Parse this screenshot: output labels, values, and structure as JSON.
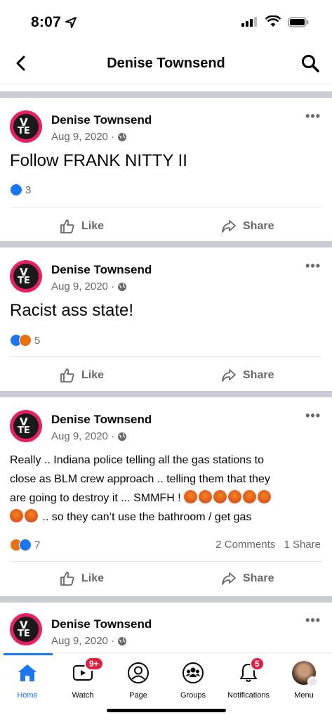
{
  "status_bar": {
    "time": "8:07"
  },
  "header": {
    "title": "Denise Townsend"
  },
  "avatar": {
    "top": "V",
    "bottom": "TE"
  },
  "posts": [
    {
      "author": "Denise Townsend",
      "date": "Aug 9, 2020 ·",
      "text": "Follow FRANK NITTY  II",
      "reaction_count": "3",
      "like_label": "Like",
      "share_label": "Share"
    },
    {
      "author": "Denise Townsend",
      "date": "Aug 9, 2020 ·",
      "text": "Racist ass state!",
      "reaction_count": "5",
      "like_label": "Like",
      "share_label": "Share"
    },
    {
      "author": "Denise Townsend",
      "date": "Aug 9, 2020 ·",
      "text_lines": [
        "Really .. Indiana police telling all the gas stations to",
        "close as BLM crew approach .. telling them that they",
        "are going to destroy it ... SMMFH !",
        ".. so they can’t use the bathroom / get gas"
      ],
      "reaction_count": "7",
      "comments": "2 Comments",
      "shares": "1 Share",
      "like_label": "Like",
      "share_label": "Share"
    },
    {
      "author": "Denise Townsend",
      "date": "Aug 9, 2020 ·"
    }
  ],
  "more_label": "•••",
  "nav": {
    "home": "Home",
    "watch": "Watch",
    "page": "Page",
    "groups": "Groups",
    "notifications": "Notifications",
    "menu": "Menu",
    "watch_badge": "9+",
    "notifications_badge": "5"
  },
  "colors": {
    "accent": "#1877f2",
    "angry": "#e9710f",
    "badge": "#e41e3f"
  }
}
